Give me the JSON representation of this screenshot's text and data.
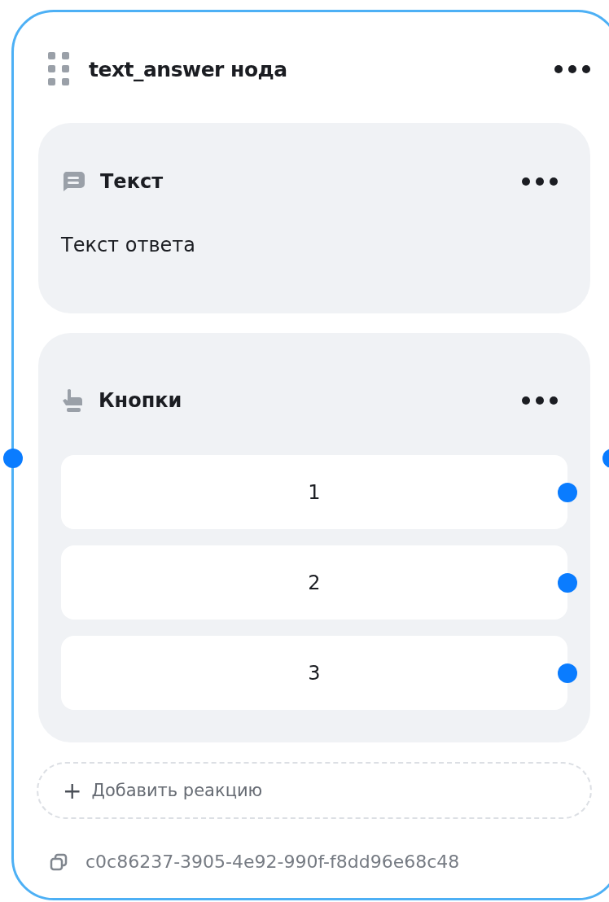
{
  "node": {
    "title": "text_answer нода",
    "blocks": [
      {
        "kind": "text",
        "title": "Текст",
        "body": "Текст ответа"
      },
      {
        "kind": "buttons",
        "title": "Кнопки",
        "buttons": [
          "1",
          "2",
          "3"
        ]
      }
    ],
    "add_reaction": {
      "icon": "+",
      "label": "Добавить реакцию"
    },
    "id": "c0c86237-3905-4e92-990f-f8dd96e68c48"
  }
}
